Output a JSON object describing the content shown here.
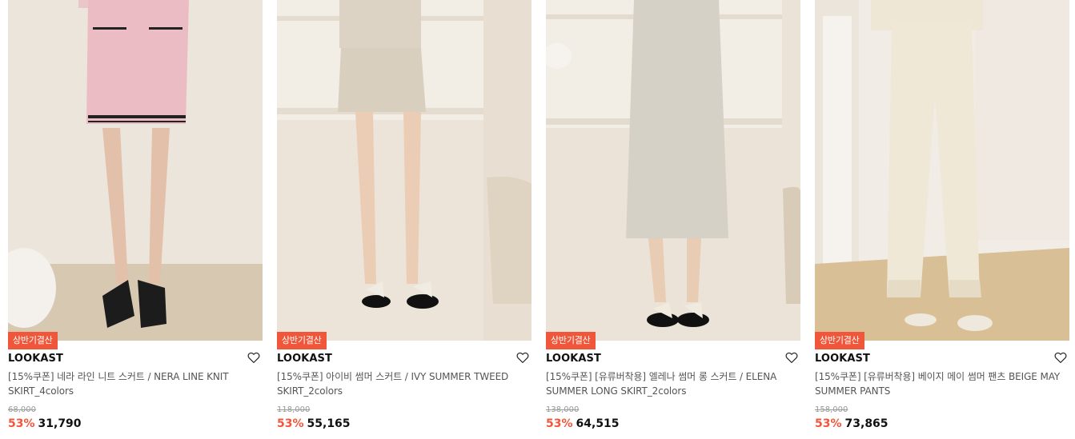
{
  "products": [
    {
      "badge": "상반기결산",
      "brand": "LOOKAST",
      "name": "[15%쿠폰] 네라 라인 니트 스커트 / NERA LINE KNIT SKIRT_4colors",
      "original_price": "68,000",
      "discount": "53%",
      "price": "31,790",
      "image": "pink-knit-skirt-photo"
    },
    {
      "badge": "상반기결산",
      "brand": "LOOKAST",
      "name": "[15%쿠폰] 아이비 썸머 스커트 / IVY SUMMER TWEED SKIRT_2colors",
      "original_price": "118,000",
      "discount": "53%",
      "price": "55,165",
      "image": "beige-tweed-skirt-photo"
    },
    {
      "badge": "상반기결산",
      "brand": "LOOKAST",
      "name": "[15%쿠폰] [유류버착용] 엘레나 썸머 롱 스커트 / ELENA SUMMER LONG SKIRT_2colors",
      "original_price": "138,000",
      "discount": "53%",
      "price": "64,515",
      "image": "grey-long-skirt-photo"
    },
    {
      "badge": "상반기결산",
      "brand": "LOOKAST",
      "name": "[15%쿠폰] [유류버착용] 베이지 메이 썸머 팬츠 BEIGE MAY SUMMER PANTS",
      "original_price": "158,000",
      "discount": "53%",
      "price": "73,865",
      "image": "beige-summer-pants-photo"
    }
  ],
  "colors": {
    "accent": "#f0563a",
    "badge_bg": "#f0563a",
    "text": "#111111",
    "muted": "#999999"
  }
}
